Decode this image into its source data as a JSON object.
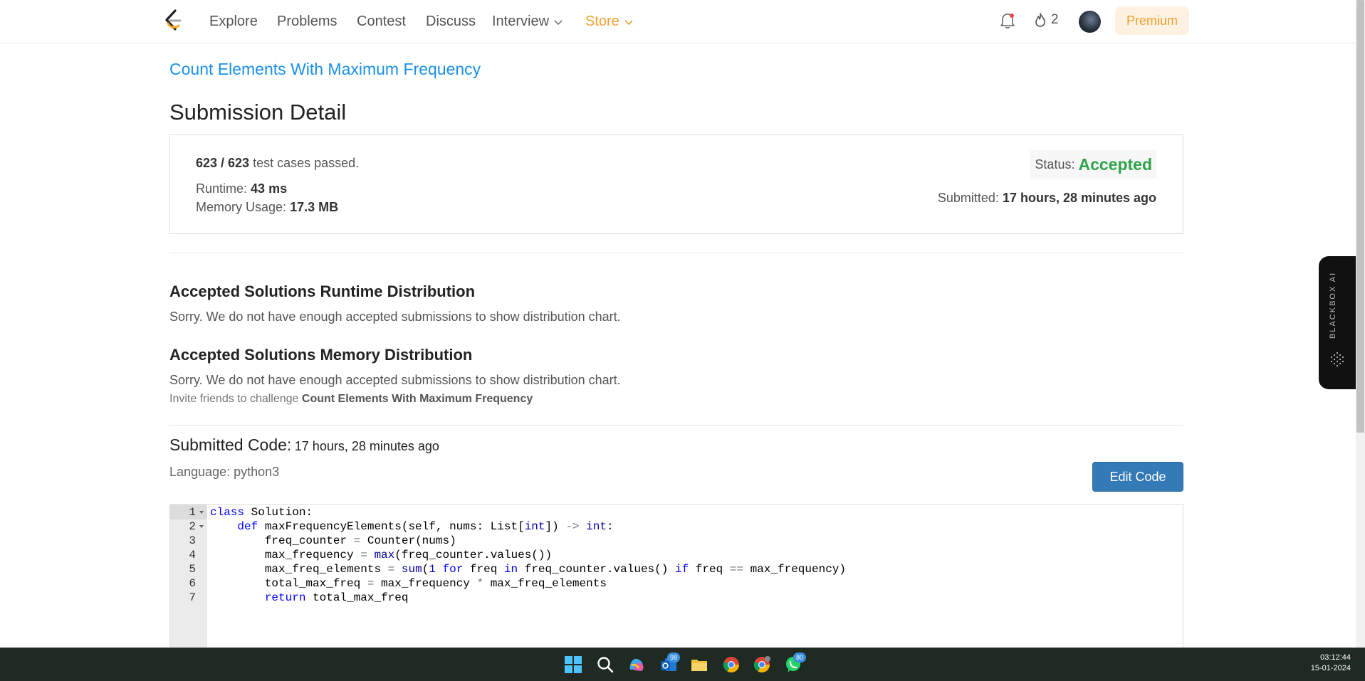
{
  "nav": {
    "items": [
      {
        "label": "Explore"
      },
      {
        "label": "Problems"
      },
      {
        "label": "Contest"
      },
      {
        "label": "Discuss"
      },
      {
        "label": "Interview"
      },
      {
        "label": "Store"
      }
    ],
    "streak_count": "2",
    "premium_label": "Premium",
    "store_color": "#f0a030"
  },
  "problem_title": "Count Elements With Maximum Frequency",
  "page_heading": "Submission Detail",
  "detail": {
    "passed": "623 / 623",
    "passed_suffix": "test cases passed.",
    "runtime_label": "Runtime:",
    "runtime_value": "43 ms",
    "memory_label": "Memory Usage:",
    "memory_value": "17.3 MB",
    "status_label": "Status:",
    "status_value": "Accepted",
    "status_color": "#2fa34a",
    "submitted_label": "Submitted:",
    "submitted_value": "17 hours, 28 minutes ago"
  },
  "runtime_dist": {
    "title": "Accepted Solutions Runtime Distribution",
    "text": "Sorry. We do not have enough accepted submissions to show distribution chart."
  },
  "memory_dist": {
    "title": "Accepted Solutions Memory Distribution",
    "text": "Sorry. We do not have enough accepted submissions to show distribution chart."
  },
  "invite": {
    "prefix": "Invite friends to challenge",
    "problem": "Count Elements With Maximum Frequency"
  },
  "code_section": {
    "label": "Submitted Code:",
    "time": "17 hours, 28 minutes ago",
    "language": "Language: python3",
    "edit_button": "Edit Code",
    "line_numbers": [
      "1",
      "2",
      "3",
      "4",
      "5",
      "6",
      "7"
    ]
  },
  "blackbox": {
    "label": "BLACKBOX AI"
  },
  "taskbar": {
    "badges": {
      "outlook": "98",
      "whatsapp": "80"
    },
    "time": "03:12:44",
    "date": "15-01-2024"
  }
}
